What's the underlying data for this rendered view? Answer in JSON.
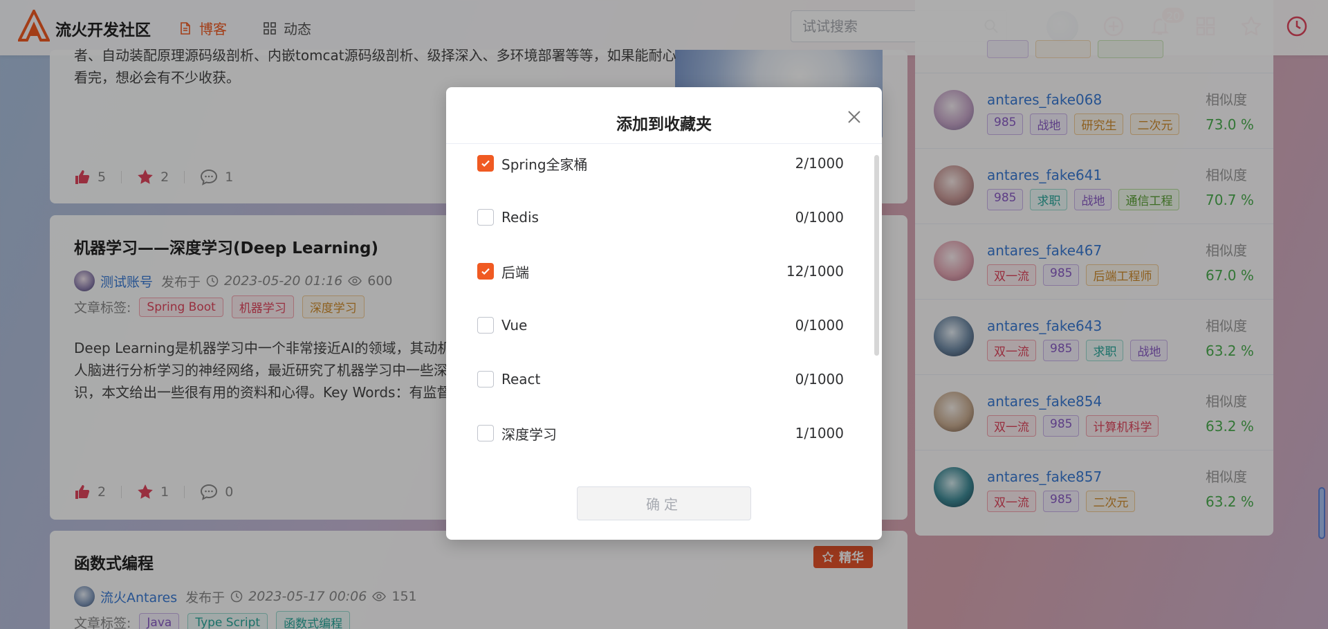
{
  "header": {
    "site_name": "流火开发社区",
    "nav": [
      {
        "label": "博客",
        "icon": "document-icon",
        "active": true
      },
      {
        "label": "动态",
        "icon": "grid-icon",
        "active": false
      }
    ],
    "search": {
      "placeholder": "试试搜索"
    },
    "notification_count": "20",
    "accent_color": "#f05a22"
  },
  "cards": [
    {
      "text_tail": "者、自动装配原理源码级剖析、内嵌tomcat源码级剖析、级择深入、多环境部署等等，如果能耐心看完，想必会有不少收获。",
      "likes": "5",
      "stars": "2",
      "comments": "1"
    },
    {
      "title": "机器学习——深度学习(Deep Learning)",
      "author": "测试账号",
      "published": "发布于",
      "date": "2023-05-20 01:16",
      "views": "600",
      "tags_label": "文章标签:",
      "tags": [
        {
          "label": "Spring Boot",
          "color": "red"
        },
        {
          "label": "机器学习",
          "color": "red"
        },
        {
          "label": "深度学习",
          "color": "orange"
        }
      ],
      "text": "Deep Learning是机器学习中一个非常接近AI的领域，其动机在于建立、模拟人脑进行分析学习的神经网络，最近研究了机器学习中一些深度学习的相关知识，本文给出一些很有用的资料和心得。Key Words：有监督学习与无监督...",
      "likes": "2",
      "stars": "1",
      "comments": "0"
    },
    {
      "title": "函数式编程",
      "essence": "精华",
      "author": "流火Antares",
      "published": "发布于",
      "date": "2023-05-17 00:06",
      "views": "151",
      "tags_label": "文章标签:",
      "tags": [
        {
          "label": "Java",
          "color": "purple"
        },
        {
          "label": "Type Script",
          "color": "teal"
        },
        {
          "label": "函数式编程",
          "color": "teal"
        }
      ]
    }
  ],
  "sidebar": {
    "users": [
      {
        "name": "antares_fake068",
        "tags": [
          {
            "label": "985",
            "color": "purple"
          },
          {
            "label": "战地",
            "color": "purple"
          },
          {
            "label": "研究生",
            "color": "orange"
          },
          {
            "label": "二次元",
            "color": "orange"
          }
        ],
        "sim_label": "相似度",
        "similarity": "73.0 %"
      },
      {
        "name": "antares_fake641",
        "tags": [
          {
            "label": "985",
            "color": "purple"
          },
          {
            "label": "求职",
            "color": "teal"
          },
          {
            "label": "战地",
            "color": "purple"
          },
          {
            "label": "通信工程",
            "color": "green"
          }
        ],
        "sim_label": "相似度",
        "similarity": "70.7 %"
      },
      {
        "name": "antares_fake467",
        "tags": [
          {
            "label": "双一流",
            "color": "red"
          },
          {
            "label": "985",
            "color": "purple"
          },
          {
            "label": "后端工程师",
            "color": "orange"
          }
        ],
        "sim_label": "相似度",
        "similarity": "67.0 %"
      },
      {
        "name": "antares_fake643",
        "tags": [
          {
            "label": "双一流",
            "color": "red"
          },
          {
            "label": "985",
            "color": "purple"
          },
          {
            "label": "求职",
            "color": "teal"
          },
          {
            "label": "战地",
            "color": "purple"
          }
        ],
        "sim_label": "相似度",
        "similarity": "63.2 %"
      },
      {
        "name": "antares_fake854",
        "tags": [
          {
            "label": "双一流",
            "color": "red"
          },
          {
            "label": "985",
            "color": "purple"
          },
          {
            "label": "计算机科学",
            "color": "red"
          }
        ],
        "sim_label": "相似度",
        "similarity": "63.2 %"
      },
      {
        "name": "antares_fake857",
        "tags": [
          {
            "label": "双一流",
            "color": "red"
          },
          {
            "label": "985",
            "color": "purple"
          },
          {
            "label": "二次元",
            "color": "orange"
          }
        ],
        "sim_label": "相似度",
        "similarity": "63.2 %"
      }
    ]
  },
  "dialog": {
    "title": "添加到收藏夹",
    "items": [
      {
        "name": "Spring全家桶",
        "count": "2/1000",
        "checked": true
      },
      {
        "name": "Redis",
        "count": "0/1000",
        "checked": false
      },
      {
        "name": "后端",
        "count": "12/1000",
        "checked": true
      },
      {
        "name": "Vue",
        "count": "0/1000",
        "checked": false
      },
      {
        "name": "React",
        "count": "0/1000",
        "checked": false
      },
      {
        "name": "深度学习",
        "count": "1/1000",
        "checked": false
      }
    ],
    "confirm_label": "确定"
  }
}
